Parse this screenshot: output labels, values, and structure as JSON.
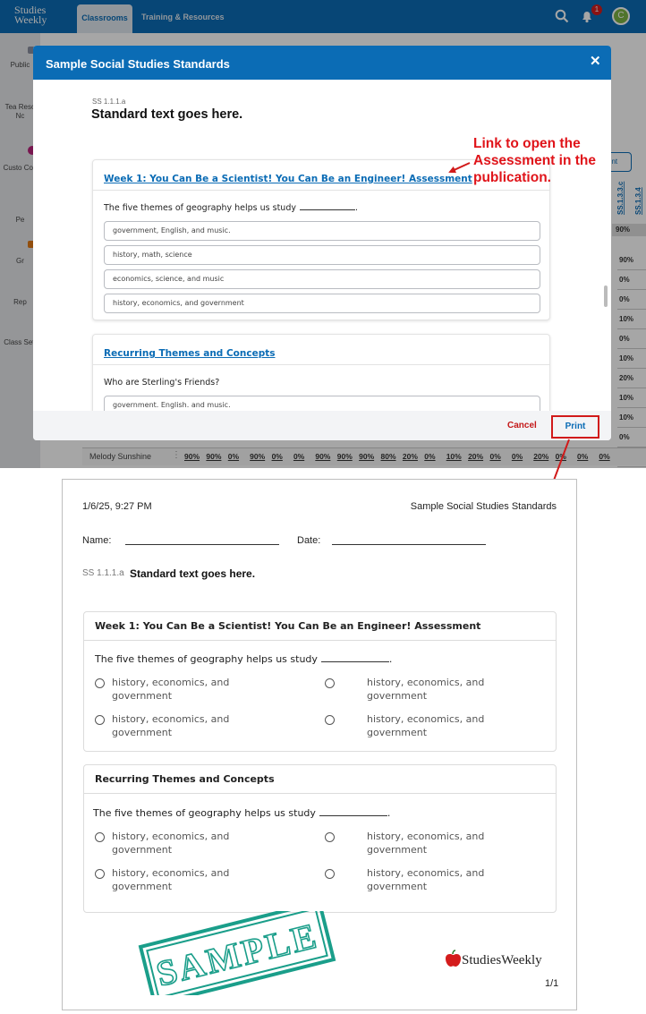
{
  "app": {
    "logo": "Studies Weekly",
    "tabs": [
      "Classrooms",
      "Training & Resources"
    ],
    "notification_count": "1",
    "avatar_initial": "C",
    "sidebar": [
      "Public",
      "Tea Reso Nc",
      "Custo Con",
      "Pe",
      "Gr",
      "Rep",
      "Class Sett"
    ],
    "print_button": "rint",
    "grid_headers": [
      "SS.1.3.3.c",
      "SS.1.3.4"
    ],
    "grid_values": [
      "90%",
      "90%",
      "0%",
      "0%",
      "10%",
      "0%",
      "10%",
      "20%",
      "10%",
      "10%",
      "0%",
      "0%"
    ],
    "student_row": {
      "name": "Melody Sunshine",
      "values": [
        "90%",
        "90%",
        "0%",
        "90%",
        "0%",
        "0%",
        "90%",
        "90%",
        "90%",
        "80%",
        "20%",
        "0%",
        "10%",
        "20%",
        "0%",
        "0%",
        "20%",
        "0%",
        "0%",
        "0%"
      ]
    }
  },
  "modal": {
    "title": "Sample Social Studies Standards",
    "standard_code": "SS 1.1.1.a",
    "standard_text": "Standard text goes here.",
    "cards": [
      {
        "link": "Week 1: You Can Be a Scientist! You Can Be an Engineer! Assessment",
        "question": "The five themes of geography helps us study",
        "options": [
          "government, English, and music.",
          "history, math, science",
          "economics, science, and music",
          "history, economics, and government"
        ]
      },
      {
        "link": "Recurring Themes and Concepts",
        "question": "Who are Sterling's Friends?",
        "options": [
          "government. English. and music."
        ]
      }
    ],
    "cancel": "Cancel",
    "print": "Print"
  },
  "annotation": [
    "Link to open the",
    "Assessment in the",
    "publication."
  ],
  "preview": {
    "datetime": "1/6/25, 9:27 PM",
    "title": "Sample Social Studies Standards",
    "name_label": "Name:",
    "date_label": "Date:",
    "standard_code": "SS 1.1.1.a",
    "standard_text": "Standard text goes here.",
    "cards": [
      {
        "title": "Week 1: You Can Be a Scientist! You Can Be an Engineer! Assessment",
        "question": "The five themes of geography helps us study",
        "options": [
          "history, economics, and government",
          "history, economics, and government",
          "history, economics, and government",
          "history, economics, and government"
        ]
      },
      {
        "title": "Recurring Themes and Concepts",
        "question": "The five themes of geography helps us study",
        "options": [
          "history, economics, and government",
          "history, economics, and government",
          "history, economics, and government",
          "history, economics, and government"
        ]
      }
    ],
    "logo": "StudiesWeekly",
    "page": "1/1",
    "stamp": "SAMPLE"
  },
  "colors": {
    "brand": "#0b6cb5",
    "annotation": "#e0141a",
    "stamp": "#1a9e8a"
  }
}
